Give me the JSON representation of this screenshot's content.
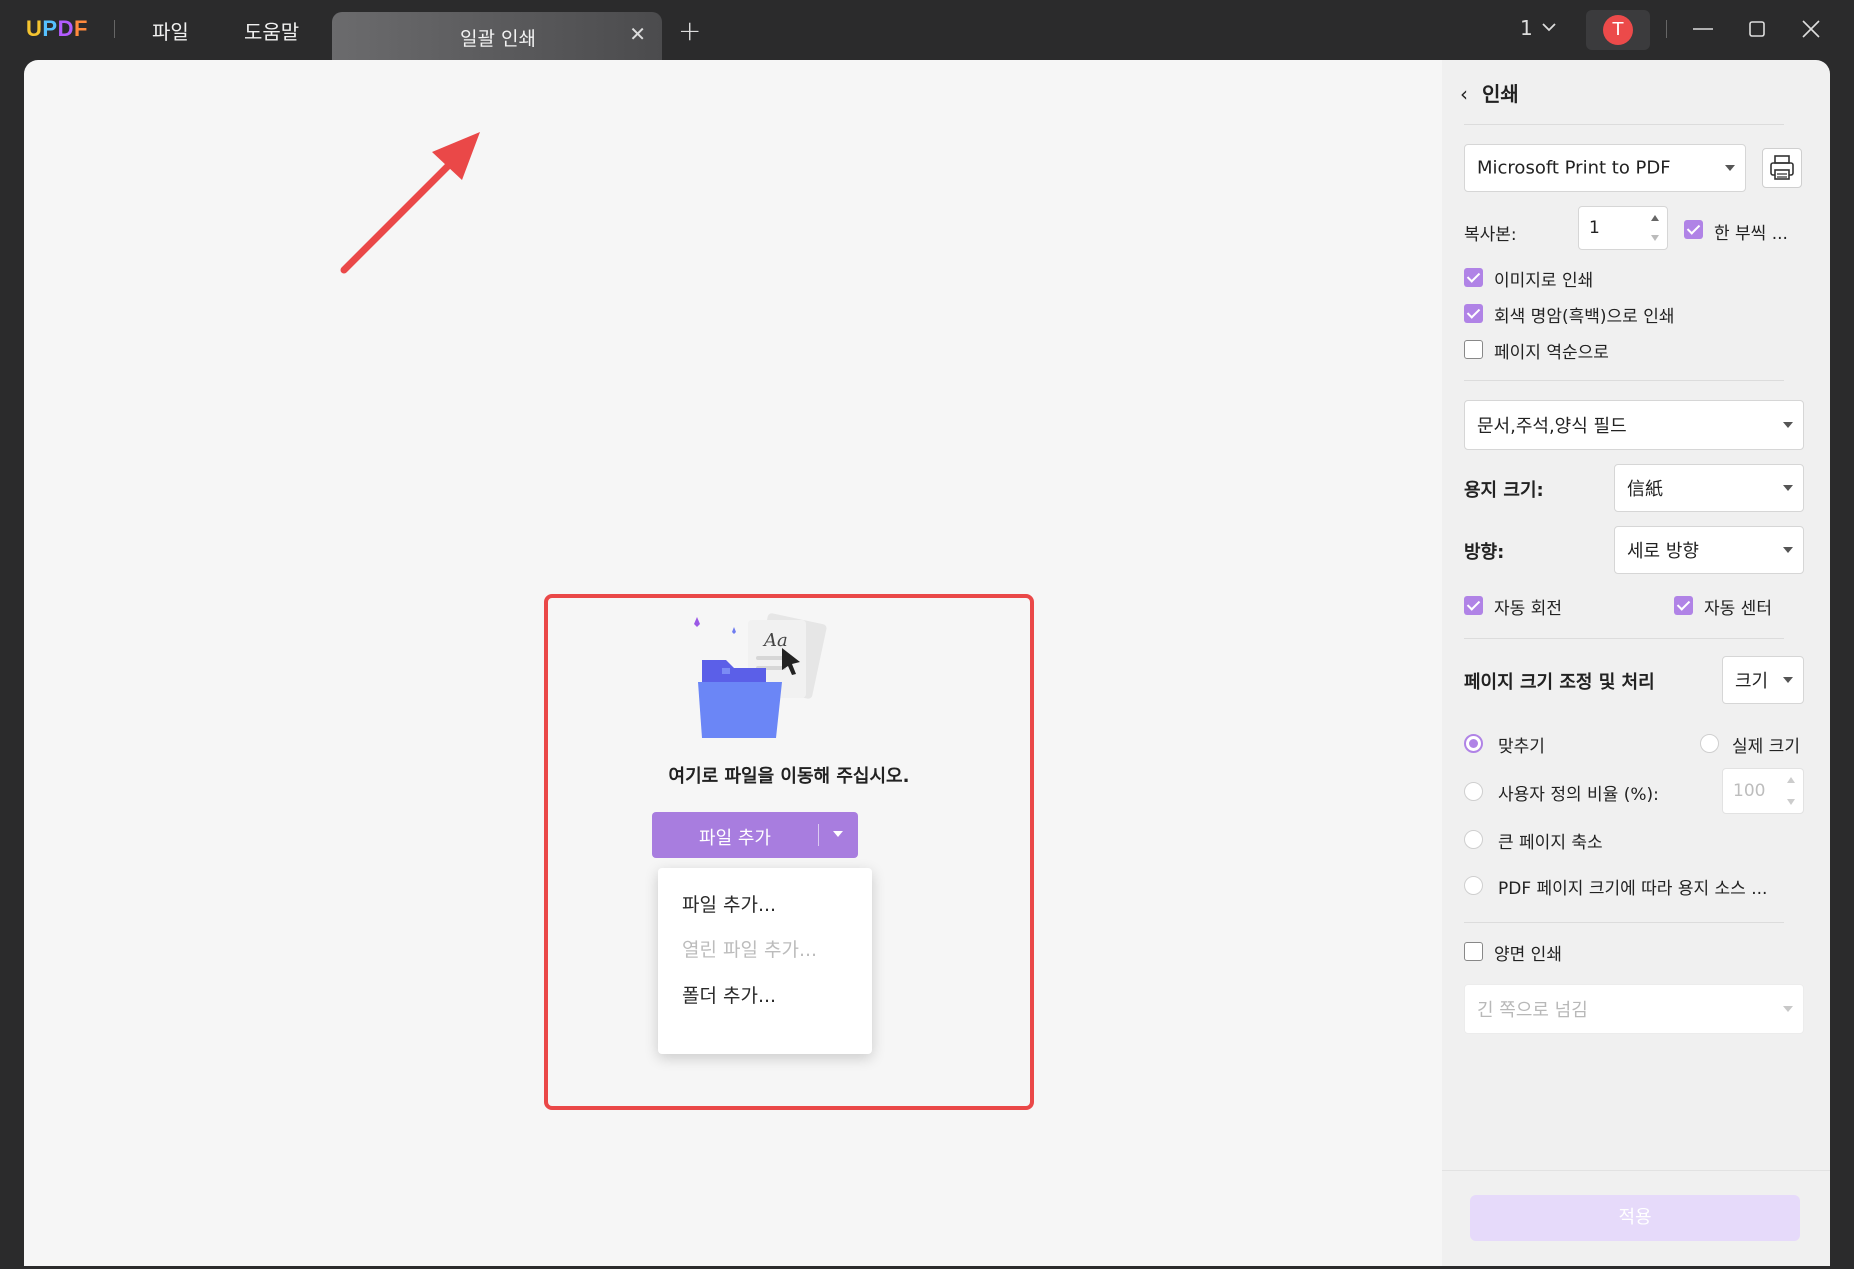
{
  "app": {
    "logo": {
      "u": "U",
      "p": "P",
      "d": "D",
      "f": "F"
    }
  },
  "menu": {
    "file": "파일",
    "help": "도움말"
  },
  "tab": {
    "label": "일괄 인쇄",
    "close": "✕",
    "add": "+"
  },
  "topbar": {
    "page_number": "1",
    "avatar_letter": "T"
  },
  "dropzone": {
    "message": "여기로 파일을 이동해 주십시오.",
    "add_button": "파일 추가",
    "menu": [
      "파일 추가...",
      "열린 파일 추가...",
      "폴더 추가..."
    ]
  },
  "panel": {
    "title": "인쇄",
    "printer": "Microsoft Print to PDF",
    "copies_label": "복사본:",
    "copies_value": "1",
    "collate_label": "한 부씩 ...",
    "print_as_image": "이미지로 인쇄",
    "print_grayscale": "회색 명암(흑백)으로 인쇄",
    "reverse_pages": "페이지 역순으로",
    "content_select": "문서,주석,양식 필드",
    "paper_size_label": "용지 크기:",
    "paper_size_value": "信紙",
    "orientation_label": "방향:",
    "orientation_value": "세로 방향",
    "auto_rotate": "자동 회전",
    "auto_center": "자동 센터",
    "page_sizing_label": "페이지 크기 조정 및 처리",
    "page_sizing_value": "크기",
    "fit": "맞추기",
    "actual_size": "실제 크기",
    "custom_scale": "사용자 정의 비율 (%):",
    "custom_scale_value": "100",
    "shrink_large": "큰 페이지 축소",
    "choose_paper_source": "PDF 페이지 크기에 따라 용지 소스 ...",
    "duplex": "양면 인쇄",
    "flip_select": "긴 쪽으로 넘김",
    "apply": "적용"
  },
  "colors": {
    "accent": "#a87ddf",
    "highlight": "#ea4848",
    "titlebar": "#2b2b2c"
  }
}
